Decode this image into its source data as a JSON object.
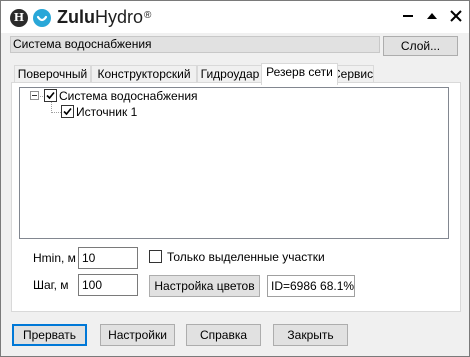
{
  "app": {
    "brand_part1": "Zulu",
    "brand_part2": "Hydro",
    "registered": "®",
    "logo_letter": "H"
  },
  "window_controls": [
    "minimize-icon",
    "maximize-icon",
    "close-icon"
  ],
  "layer": {
    "value": "Система водоснабжения",
    "button_label": "Слой..."
  },
  "tabs": [
    {
      "label": "Поверочный",
      "active": false
    },
    {
      "label": "Конструкторский",
      "active": false
    },
    {
      "label": "Гидроудар",
      "active": false
    },
    {
      "label": "Резерв сети",
      "active": true
    },
    {
      "label": "Сервис",
      "active": false
    }
  ],
  "tree": {
    "root": {
      "label": "Система водоснабжения",
      "checked": true,
      "expanded": true
    },
    "children": [
      {
        "label": "Источник 1",
        "checked": true
      }
    ]
  },
  "form": {
    "hmin_label": "Hmin, м",
    "hmin_value": "10",
    "step_label": "Шаг, м",
    "step_value": "100",
    "only_selected_label": "Только выделенные участки",
    "only_selected_checked": false,
    "color_settings_label": "Настройка цветов",
    "status_text": "ID=6986 68.1%"
  },
  "buttons": {
    "abort": "Прервать",
    "settings": "Настройки",
    "help": "Справка",
    "close": "Закрыть"
  },
  "colors": {
    "accent": "#0078d7",
    "logo_blue": "#29a7d8"
  }
}
